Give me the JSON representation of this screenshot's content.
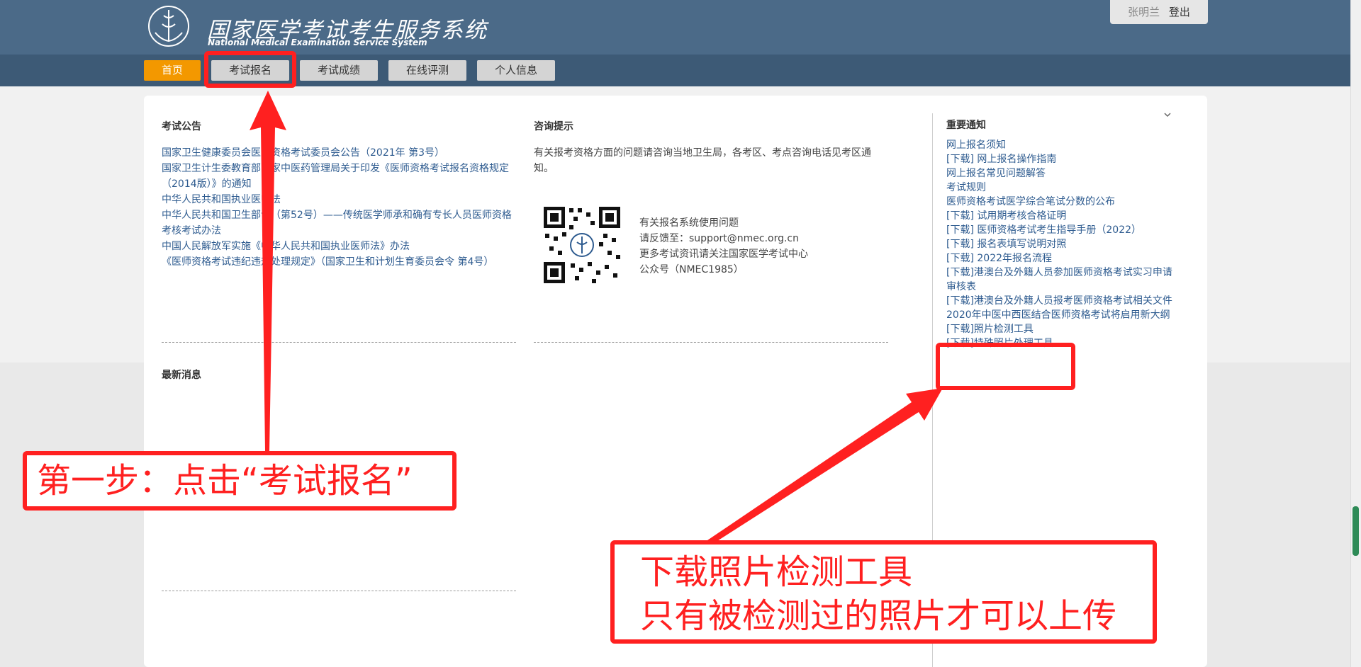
{
  "header": {
    "title_cn": "国家医学考试考生服务系统",
    "title_en": "National Medical Examination Service System",
    "user_name": "张明兰",
    "logout_label": "登出"
  },
  "nav": {
    "items": [
      {
        "label": "首页",
        "active": true
      },
      {
        "label": "考试报名",
        "active": false
      },
      {
        "label": "考试成绩",
        "active": false
      },
      {
        "label": "在线评测",
        "active": false
      },
      {
        "label": "个人信息",
        "active": false
      }
    ],
    "active_color": "#f39800"
  },
  "announcements": {
    "title": "考试公告",
    "items": [
      "国家卫生健康委员会医师资格考试委员会公告（2021年 第3号）",
      "国家卫生计生委教育部国家中医药管理局关于印发《医师资格考试报名资格规定（2014版）》的通知",
      "中华人民共和国执业医师法",
      "中华人民共和国卫生部令（第52号）——传统医学师承和确有专长人员医师资格考核考试办法",
      "中国人民解放军实施《中华人民共和国执业医师法》办法",
      "《医师资格考试违纪违规处理规定》（国家卫生和计划生育委员会令 第4号）"
    ]
  },
  "consult": {
    "title": "咨询提示",
    "text": "有关报考资格方面的问题请咨询当地卫生局，各考区、考点咨询电话见考区通知。",
    "contact_lines": [
      "有关报名系统使用问题",
      "请反馈至：support@nmec.org.cn",
      "更多考试资讯请关注国家医学考试中心",
      "公众号（NMEC1985）"
    ]
  },
  "news": {
    "title": "最新消息"
  },
  "notices": {
    "title": "重要通知",
    "items": [
      "网上报名须知",
      "[下载] 网上报名操作指南",
      "网上报名常见问题解答",
      "考试规则",
      "医师资格考试医学综合笔试分数的公布",
      "[下载] 试用期考核合格证明",
      "[下载] 医师资格考试考生指导手册（2022）",
      "[下载] 报名表填写说明对照",
      "[下载] 2022年报名流程",
      "[下载]港澳台及外籍人员参加医师资格考试实习申请审核表",
      "[下载]港澳台及外籍人员报考医师资格考试相关文件",
      "2020年中医中西医结合医师资格考试将启用新大纲",
      "[下载]照片检测工具",
      "[下载]特殊照片处理工具"
    ]
  },
  "annotations": {
    "step1": "第一步：点击“考试报名”",
    "tool_line1": "下载照片检测工具",
    "tool_line2": "只有被检测过的照片才可以上传",
    "color": "#ff2020"
  }
}
